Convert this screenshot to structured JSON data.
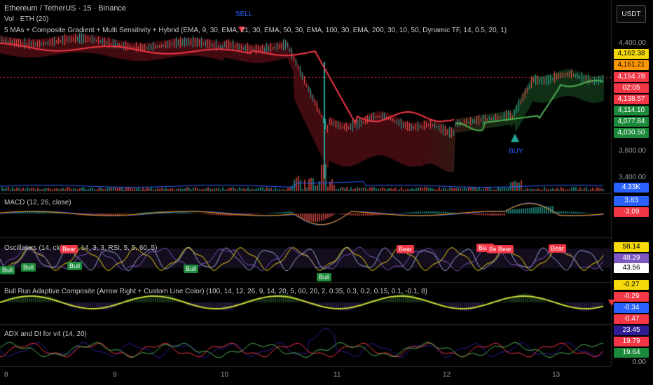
{
  "header": {
    "symbol": "Ethereum / TetherUS · 15 · Binance",
    "volume": "Vol · ETH (20)",
    "mas": "5 MAs + Composite Gradient + Multi Sensitivity + Hybrid (EMA, 9, 30, EMA, 21, 30, EMA, 50, 30, EMA, 100, 30, EMA, 200, 30, 10, 50, Dynamic TF, 14, 0.5, 20, 1)"
  },
  "currency_button": "USDT",
  "price_axis": {
    "ticks": [
      "4,400.00",
      "3,600.00",
      "3,400.00"
    ],
    "badges": [
      {
        "label": "4,162.38",
        "color": "#f5d90a",
        "text": "#000"
      },
      {
        "label": "4,161.21",
        "color": "#ff9800",
        "text": "#000"
      },
      {
        "label": "4,154.78",
        "color": "#f23645",
        "text": "#fff"
      },
      {
        "label": "02:05",
        "color": "#f23645",
        "text": "#fff"
      },
      {
        "label": "4,138.57",
        "color": "#f23645",
        "text": "#fff"
      },
      {
        "label": "4,114.10",
        "color": "#1b8a3a",
        "text": "#fff"
      },
      {
        "label": "4,077.84",
        "color": "#1b8a3a",
        "text": "#fff"
      },
      {
        "label": "4,030.50",
        "color": "#1b8a3a",
        "text": "#fff"
      },
      {
        "label": "4.33K",
        "color": "#2962ff",
        "text": "#fff"
      }
    ]
  },
  "signals": {
    "sell": "SELL",
    "buy": "BUY"
  },
  "macd": {
    "title": "MACD (12, 26, close)",
    "badges": [
      {
        "label": "3.83",
        "color": "#2962ff",
        "text": "#fff"
      },
      {
        "label": "-3.09",
        "color": "#f23645",
        "text": "#fff"
      }
    ]
  },
  "osc": {
    "title": "Oscillators (14, close, 9, 14, 3, 3, RSI, 5, 5, 60, 5)",
    "badges": [
      {
        "label": "58.14",
        "color": "#f5d90a",
        "text": "#000"
      },
      {
        "label": "48.29",
        "color": "#7e57c2",
        "text": "#fff"
      },
      {
        "label": "43.56",
        "color": "#ffffff",
        "text": "#000"
      }
    ],
    "labels": {
      "bear": "Bear",
      "bull": "Bull"
    }
  },
  "bull": {
    "title": "Bull Run Adaptive Composite (Arrow Right + Custom Line Color) (100, 14, 12, 26, 9, 14, 20, 5, 60, 20, 2, 0.35, 0.3, 0.2, 0.15, 0.1, -0.1, 8)",
    "badges": [
      {
        "label": "-0.27",
        "color": "#f5d90a",
        "text": "#000"
      },
      {
        "label": "-0.29",
        "color": "#f23645",
        "text": "#fff"
      },
      {
        "label": "-0.34",
        "color": "#2962ff",
        "text": "#fff"
      },
      {
        "label": "-0.47",
        "color": "#f23645",
        "text": "#fff"
      }
    ]
  },
  "adx": {
    "title": "ADX and DI for v4 (14, 20)",
    "badges": [
      {
        "label": "23.45",
        "color": "#311b92",
        "text": "#fff"
      },
      {
        "label": "19.79",
        "color": "#f23645",
        "text": "#fff"
      },
      {
        "label": "19.64",
        "color": "#1b8a3a",
        "text": "#fff"
      }
    ],
    "tick": "0.00"
  },
  "time_axis": [
    "8",
    "9",
    "10",
    "11",
    "12",
    "13"
  ],
  "colors": {
    "up": "#26a69a",
    "down": "#ef5350",
    "ma_red": "#f23645",
    "ma_green": "#4caf50"
  }
}
